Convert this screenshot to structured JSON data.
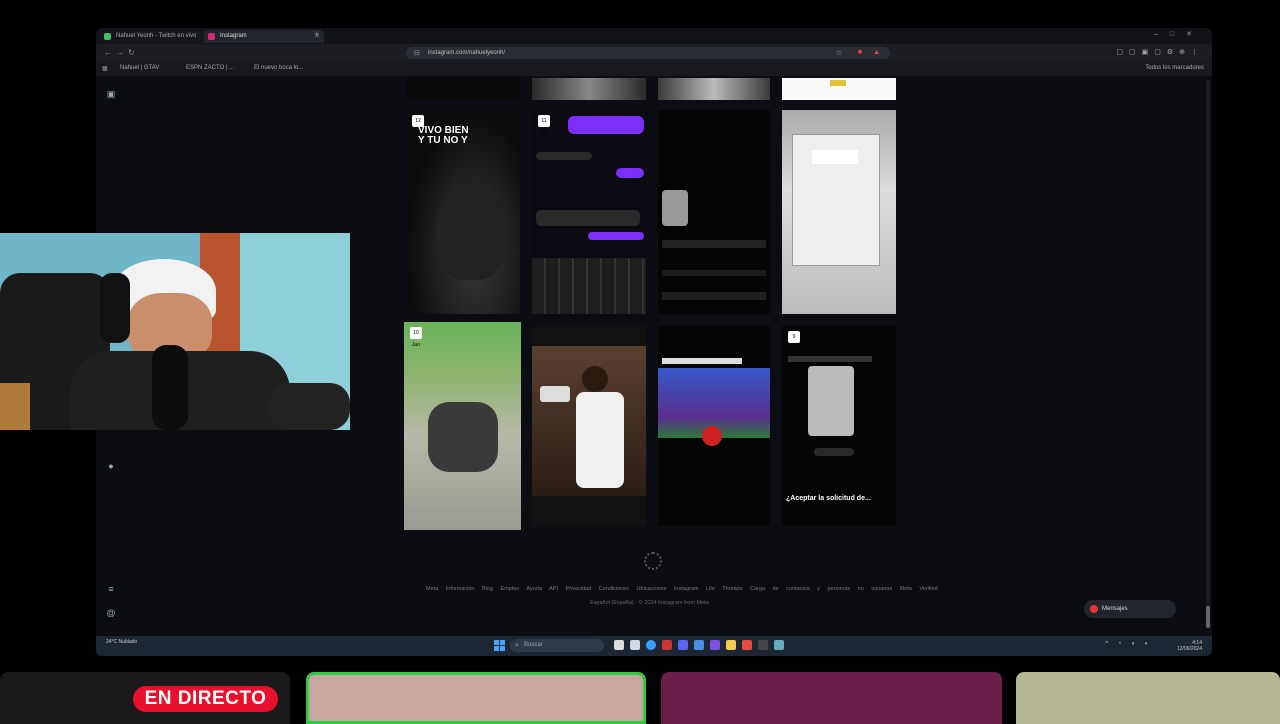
{
  "browser": {
    "tabs": [
      {
        "label": "Nahuel Yeonh - Twitch en vivo",
        "favicon_color": "#3fbf6b"
      },
      {
        "label": "Instagram",
        "favicon_color": "#d62976"
      }
    ],
    "url": "instagram.com/nahuelyeonh/",
    "bookmarks": [
      "Nahuel | GTAV",
      "ESPN ZACTO | ...",
      "El nuevo boca lo..."
    ],
    "toolbar_right": "Todos los marcadores"
  },
  "instagram": {
    "posts": [
      {
        "badge": "",
        "caption": ""
      },
      {
        "badge": "",
        "caption": ""
      },
      {
        "badge": "",
        "caption": ""
      },
      {
        "badge": "",
        "caption": ""
      },
      {
        "badge": "12 Jun",
        "caption": "VIVO BIEN Y TU NO Y"
      },
      {
        "badge": "11 Jun",
        "caption": ""
      },
      {
        "badge": "",
        "caption": ""
      },
      {
        "badge": "",
        "caption": ""
      },
      {
        "badge": "10 Jun",
        "caption": ""
      },
      {
        "badge": "",
        "caption": ""
      },
      {
        "badge": "",
        "caption": ""
      },
      {
        "badge": "9 Jun",
        "caption": "¿Aceptar la solicitud de..."
      }
    ],
    "footer_links": "Meta Información Blog Empleo Ayuda API Privacidad Condiciones Ubicaciones Instagram Lite Threads Carga de contactos y personas no usuarias Meta Verified",
    "footer_copy": "Español (España) · © 2024 Instagram from Meta",
    "messages_label": "Mensajes"
  },
  "taskbar": {
    "weather": "24°C Nublado",
    "search_placeholder": "Buscar",
    "time": "4:14",
    "date": "12/06/2024"
  },
  "stream": {
    "live_label": "EN DIRECTO"
  },
  "colors": {
    "accent_live": "#e8102d",
    "instagram_purple": "#7b2ff7",
    "taskbar": "#1d2733"
  }
}
